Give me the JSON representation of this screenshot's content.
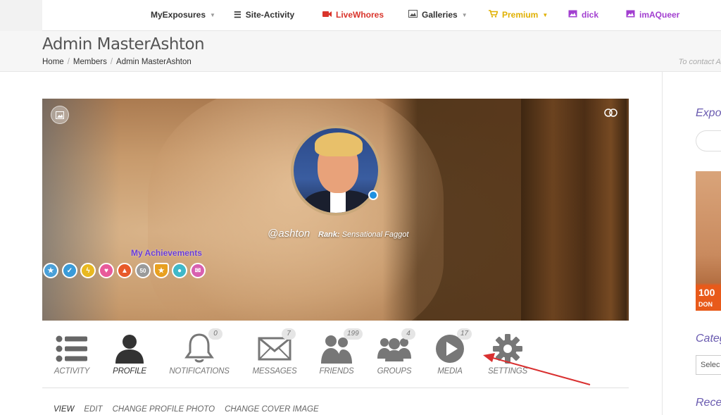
{
  "topnav": {
    "items": [
      {
        "label": "MyExposures",
        "icon": "none",
        "caret": "▼",
        "color": "#333333"
      },
      {
        "label": "Site-Activity",
        "icon": "list-icon",
        "color": "#333333"
      },
      {
        "label": "LiveWhores",
        "icon": "video-camera-icon",
        "color": "#d9342b"
      },
      {
        "label": "Galleries",
        "icon": "image-icon",
        "caret": "▼",
        "color": "#333333"
      },
      {
        "label": "Premium",
        "icon": "shopping-cart-icon",
        "caret": "▼",
        "color": "#e0b000"
      },
      {
        "label": "dick",
        "icon": "image-icon",
        "color": "#a23fd0"
      },
      {
        "label": "imAQueer",
        "icon": "image-icon",
        "color": "#a23fd0"
      }
    ]
  },
  "header": {
    "title": "Admin MasterAshton",
    "breadcrumb": [
      "Home",
      "Members",
      "Admin MasterAshton"
    ],
    "contact_text": "To contact A"
  },
  "profile": {
    "handle": "@ashton",
    "rank_label": "Rank:",
    "rank_value": "Sensational Faggot",
    "achievements_title": "My Achievements",
    "online_status_color": "#1e90e0",
    "badges": [
      {
        "name": "star-badge",
        "color": "#4aa0d8",
        "glyph": "★"
      },
      {
        "name": "thumbs-up-badge",
        "color": "#3a9bd8",
        "glyph": "👍"
      },
      {
        "name": "lightning-badge",
        "color": "#e8b820",
        "glyph": "⚡"
      },
      {
        "name": "heart-badge",
        "color": "#e85a9a",
        "glyph": "♥"
      },
      {
        "name": "rocket-badge",
        "color": "#e85a2a",
        "glyph": "▲"
      },
      {
        "name": "fifty-badge",
        "color": "#9a9a9a",
        "glyph": "50"
      },
      {
        "name": "shield-badge",
        "color": "#e8a020",
        "glyph": "⛨"
      },
      {
        "name": "monster-badge",
        "color": "#40b8c8",
        "glyph": "●"
      },
      {
        "name": "chat-badge",
        "color": "#d860b0",
        "glyph": "✉"
      }
    ]
  },
  "tabs": [
    {
      "label": "ACTIVITY",
      "icon": "list-icon",
      "count": null,
      "active": false
    },
    {
      "label": "PROFILE",
      "icon": "user-icon",
      "count": null,
      "active": true
    },
    {
      "label": "NOTIFICATIONS",
      "icon": "bell-icon",
      "count": "0",
      "active": false
    },
    {
      "label": "MESSAGES",
      "icon": "envelope-icon",
      "count": "7",
      "active": false
    },
    {
      "label": "FRIENDS",
      "icon": "friends-icon",
      "count": "199",
      "active": false
    },
    {
      "label": "GROUPS",
      "icon": "groups-icon",
      "count": "4",
      "active": false
    },
    {
      "label": "MEDIA",
      "icon": "play-icon",
      "count": "17",
      "active": false
    },
    {
      "label": "SETTINGS",
      "icon": "gear-icon",
      "count": null,
      "active": false
    }
  ],
  "subnav": [
    "VIEW",
    "EDIT",
    "CHANGE PROFILE PHOTO",
    "CHANGE COVER IMAGE"
  ],
  "sidebar": {
    "section1": "Expos",
    "section2": "Categ",
    "section3": "Recer",
    "select_value": "Selec",
    "ad_text": "100",
    "ad_subtext": "DON"
  },
  "annotation": {
    "arrow_color": "#d93030"
  }
}
